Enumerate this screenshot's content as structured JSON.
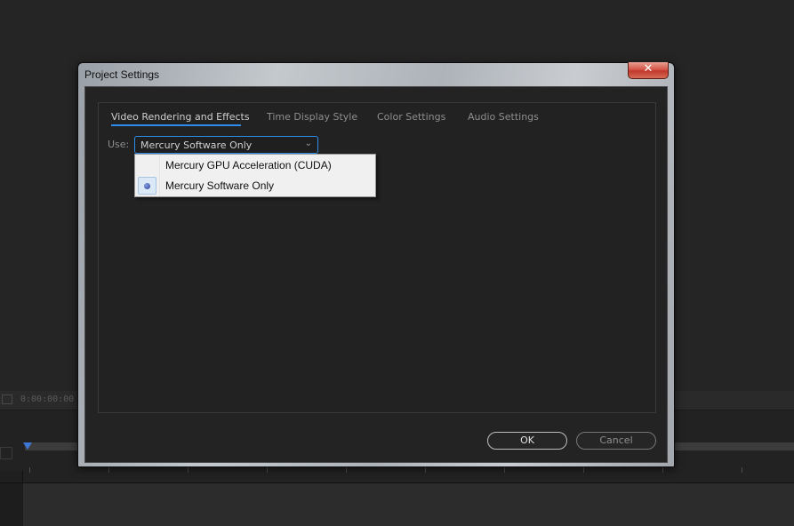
{
  "background": {
    "timecode": "0:00:00:00"
  },
  "dialog": {
    "title": "Project Settings",
    "close_label": "✕",
    "tabs": [
      {
        "label": "Video Rendering and Effects",
        "active": true
      },
      {
        "label": "Time Display Style",
        "active": false
      },
      {
        "label": "Color Settings",
        "active": false
      },
      {
        "label": "Audio Settings",
        "active": false
      }
    ],
    "use_label": "Use:",
    "renderer_select": {
      "value": "Mercury Software Only",
      "chevron": "⌄"
    },
    "renderer_options": [
      {
        "label": "Mercury GPU Acceleration (CUDA)",
        "selected": false
      },
      {
        "label": "Mercury Software Only",
        "selected": true
      }
    ],
    "ok_label": "OK",
    "cancel_label": "Cancel"
  },
  "colors": {
    "accent": "#2d8ceb",
    "dialog_bg": "#232323"
  }
}
